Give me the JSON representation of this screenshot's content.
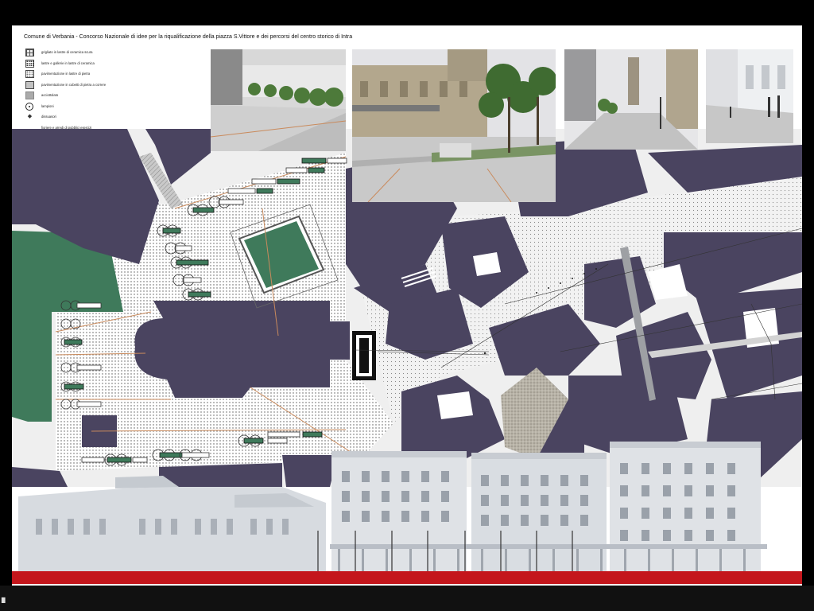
{
  "board": {
    "title": "Comune di Verbania - Concorso Nazionale di idee per la riqualificazione della piazza S.Vittore e dei percorsi del centro storico di Intra"
  },
  "legend": [
    {
      "kind": "grid",
      "icon": "grid-swatch",
      "label": "grigliato in lastre di ceramica scura"
    },
    {
      "kind": "dots",
      "icon": "dotted-swatch",
      "label": "lastre e gallerie in lastre di ceramica"
    },
    {
      "kind": "dots2",
      "icon": "dotted-swatch",
      "label": "pavimentazione in lastre di pietra"
    },
    {
      "kind": "dots3",
      "icon": "dotted-swatch",
      "label": "pavimentazione in cubetti di pietra a correre"
    },
    {
      "kind": "asphalt",
      "icon": "asphalt-swatch",
      "label": "acciottolato"
    },
    {
      "kind": "tree",
      "icon": "tree-icon",
      "label": "lampioni"
    },
    {
      "kind": "lamp",
      "icon": "lamp-icon",
      "label": "dissuasori"
    },
    {
      "kind": "note",
      "icon": "",
      "label": "fioriere e arredi di pubblici esercizi"
    }
  ],
  "colors": {
    "building": "#4a4460",
    "green": "#3f7a5b",
    "paving": "#e6e6e6",
    "facade": "#d7dbe0",
    "accent_red": "#c4161c",
    "background": "#000000"
  }
}
